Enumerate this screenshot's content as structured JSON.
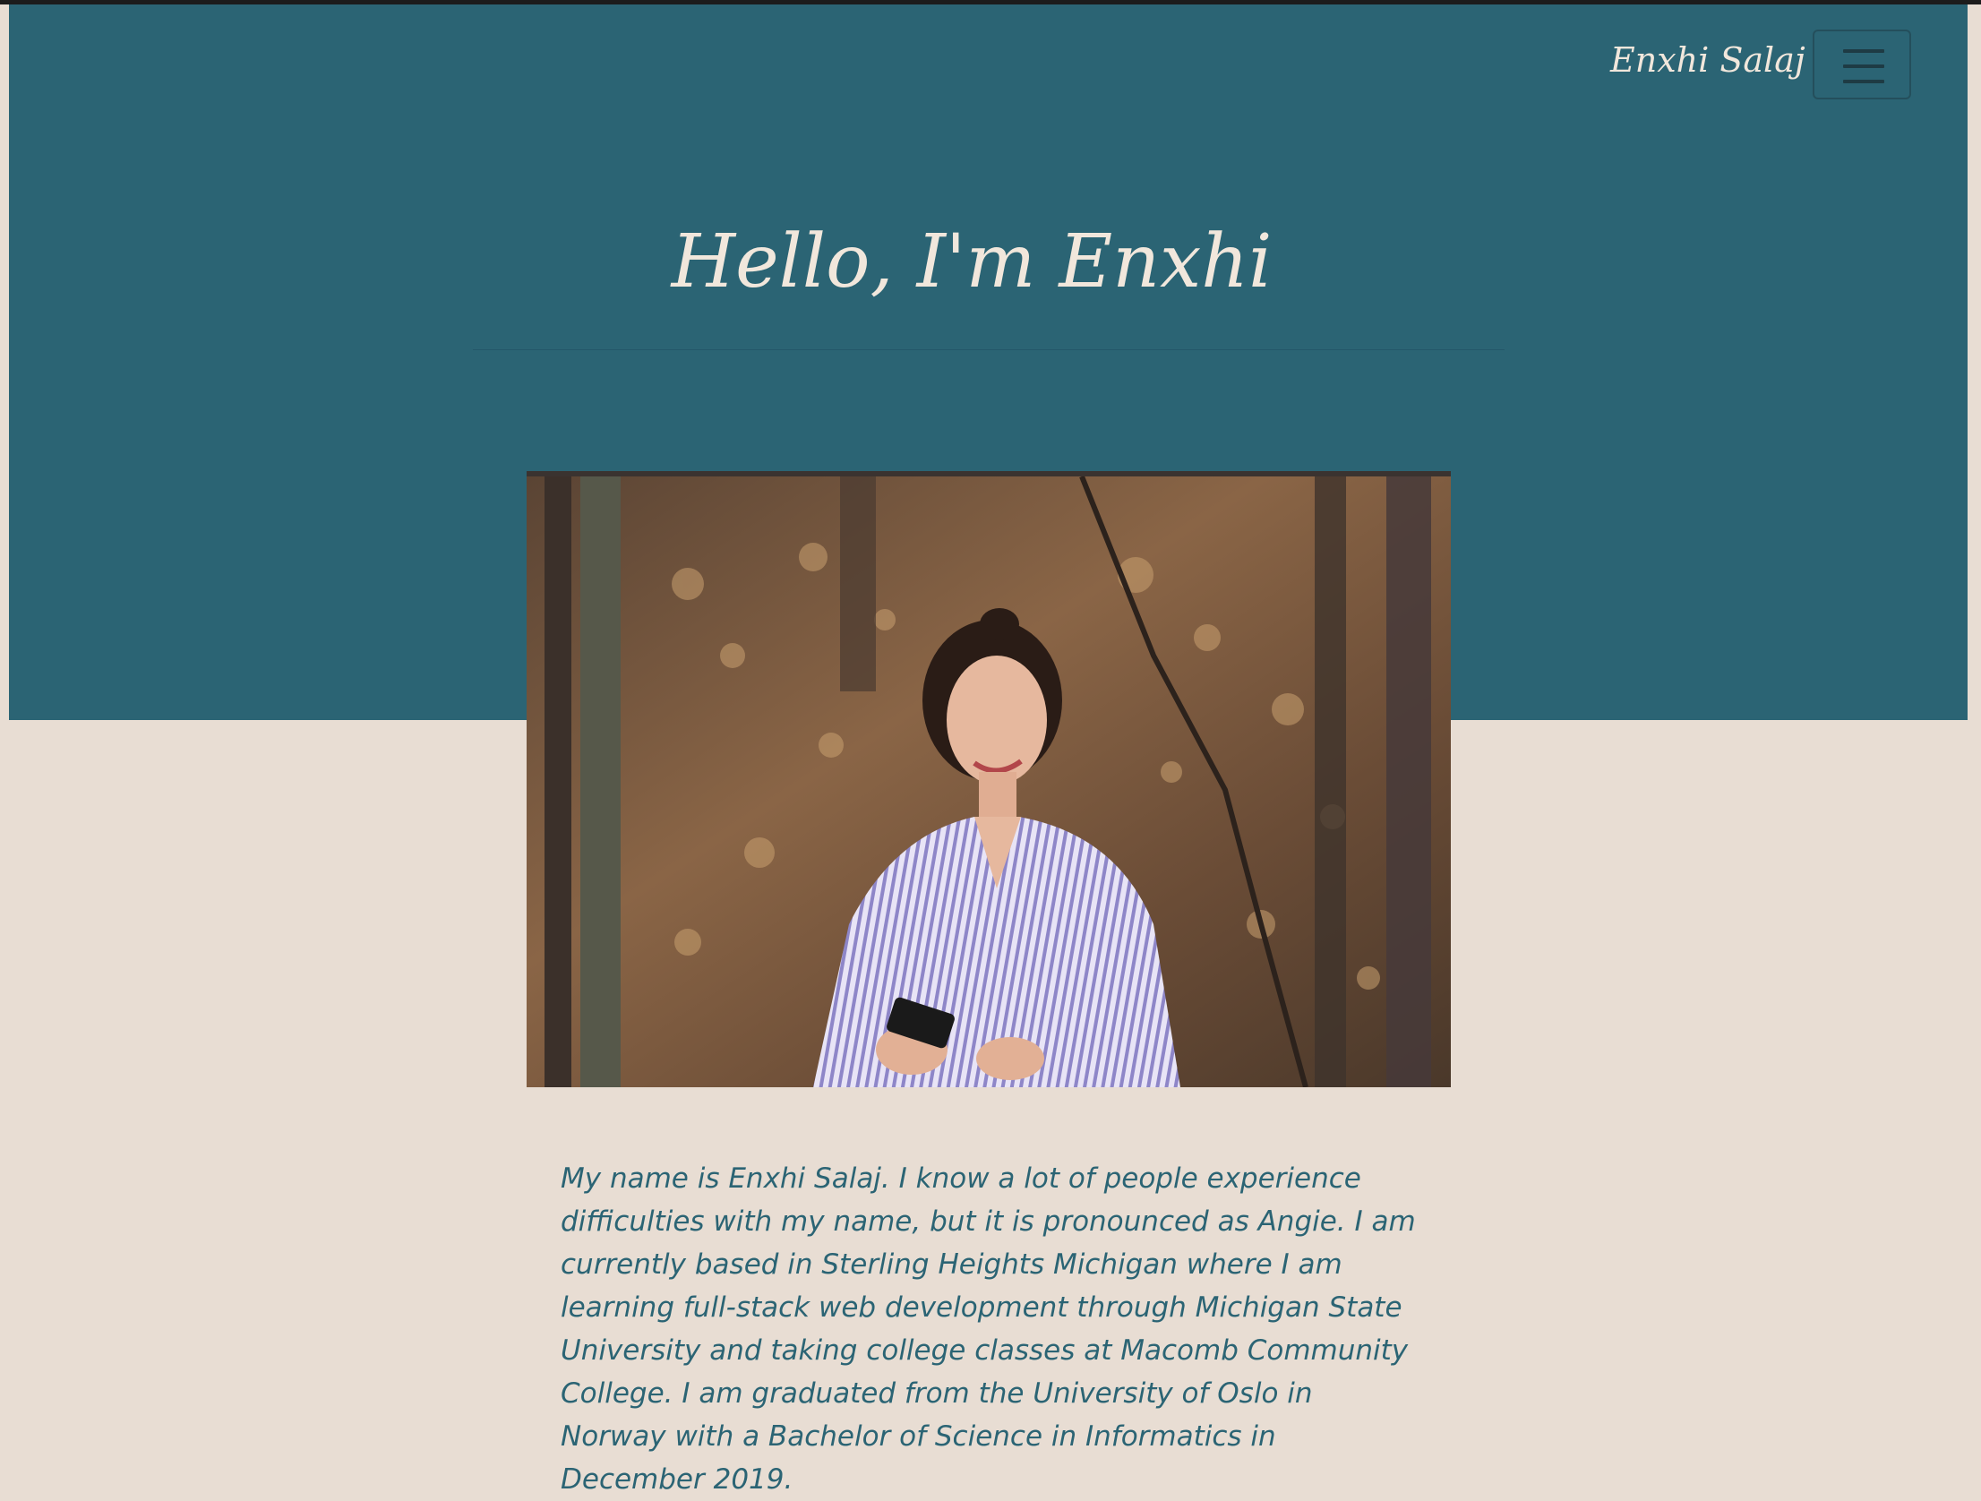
{
  "navbar": {
    "brand": "Enxhi Salaj",
    "toggle_icon": "hamburger-menu-icon"
  },
  "hero": {
    "title": "Hello, I'm Enxhi"
  },
  "about": {
    "photo_description_icon": "profile-photo",
    "bio": "My name is Enxhi Salaj. I know a lot of people experience difficulties with my name, but it is pronounced as Angie. I am currently based in Sterling Heights Michigan where I am learning full-stack web development through Michigan State University and taking college classes at Macomb Community College. I am graduated from the University of Oslo in Norway with a Bachelor of Science in Informatics in December 2019."
  },
  "colors": {
    "hero_background": "#2b6474",
    "page_background": "#e8ddd3",
    "title_text": "#f1e7dc",
    "body_text": "#2b6474"
  }
}
